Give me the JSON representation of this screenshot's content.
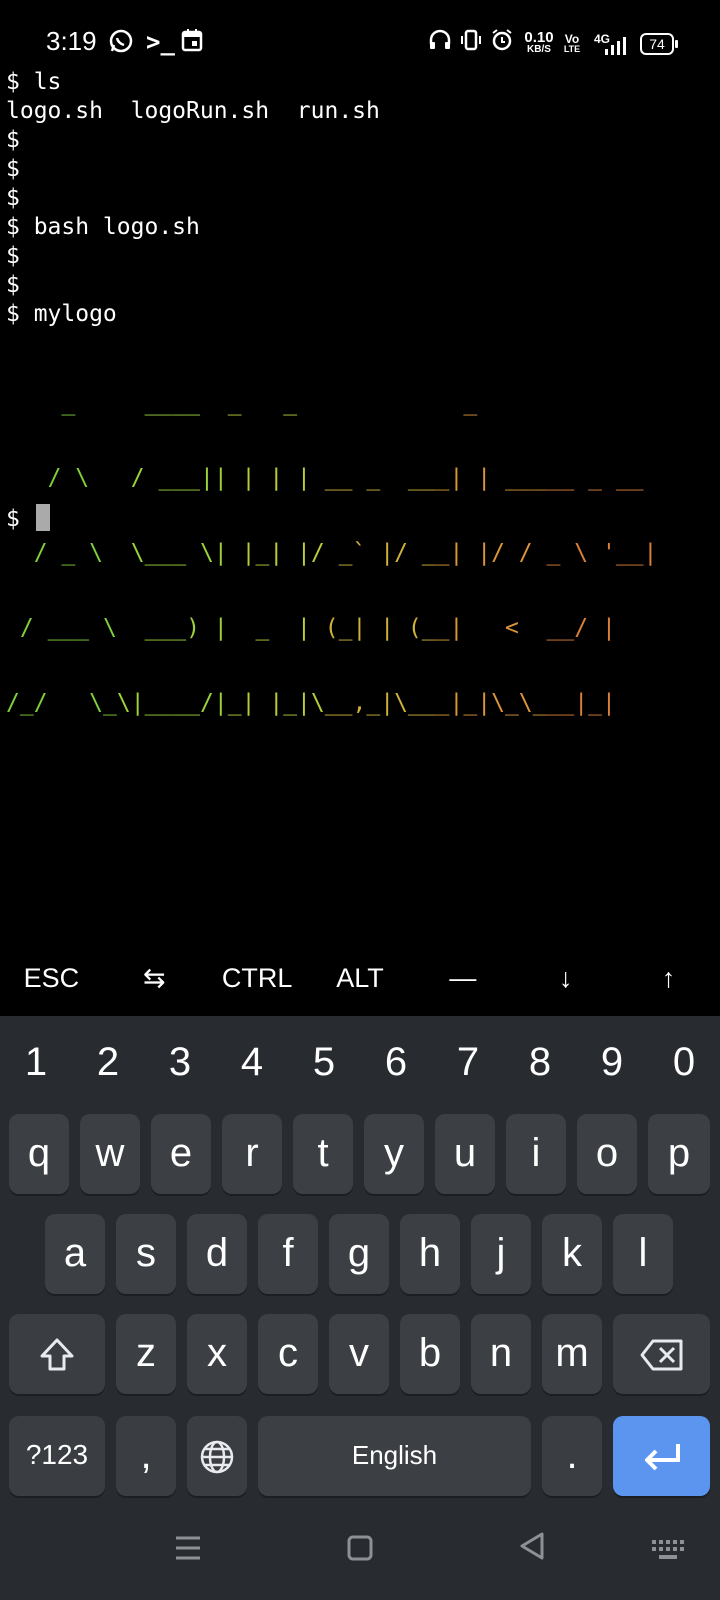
{
  "status_bar": {
    "time": "3:19",
    "net_speed_value": "0.10",
    "net_speed_unit": "KB/S",
    "volte_top": "Vo",
    "volte_bottom": "LTE",
    "network": "4G",
    "battery": "74"
  },
  "terminal": {
    "lines": [
      "$ ls",
      "logo.sh  logoRun.sh  run.sh",
      "$",
      "$",
      "$",
      "$ bash logo.sh",
      "$",
      "$",
      "$ mylogo"
    ],
    "ascii_art": [
      {
        "text": "    _     ____  _   _            _",
        "colors": [
          "#7ecf3a",
          "#7ecf3a",
          "#c9c03a",
          "#d9903a"
        ]
      },
      {
        "text": "   / \\   / ___|| | | | __ _  ___| | _____ _ __",
        "colors": [
          "#7ecf3a"
        ]
      },
      {
        "text": "  / _ \\  \\___ \\| |_| |/ _` |/ __| |/ / _ \\ '__|",
        "colors": [
          "#7ecf3a"
        ]
      },
      {
        "text": " / ___ \\  ___) |  _  | (_| | (__|   <  __/ |",
        "colors": [
          "#7ecf3a"
        ]
      },
      {
        "text": "/_/   \\_\\|____/|_| |_|\\__,_|\\___|_|\\_\\___|_|",
        "colors": [
          "#7ecf3a"
        ]
      }
    ],
    "prompt": "$ "
  },
  "extra_keys": [
    "ESC",
    "⇆",
    "CTRL",
    "ALT",
    "—",
    "↓",
    "↑"
  ],
  "keyboard": {
    "numbers": [
      "1",
      "2",
      "3",
      "4",
      "5",
      "6",
      "7",
      "8",
      "9",
      "0"
    ],
    "row1": [
      "q",
      "w",
      "e",
      "r",
      "t",
      "y",
      "u",
      "i",
      "o",
      "p"
    ],
    "row2": [
      "a",
      "s",
      "d",
      "f",
      "g",
      "h",
      "j",
      "k",
      "l"
    ],
    "row3": [
      "z",
      "x",
      "c",
      "v",
      "b",
      "n",
      "m"
    ],
    "symbols_label": "?123",
    "comma": ",",
    "space_label": "English",
    "period": "."
  }
}
